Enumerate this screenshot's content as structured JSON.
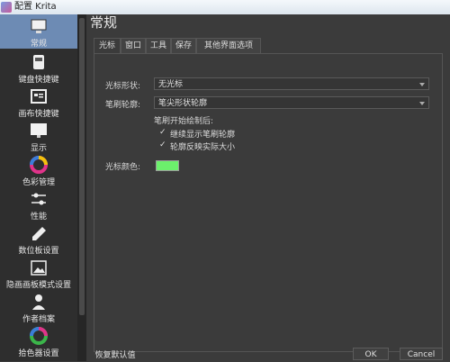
{
  "window": {
    "title": "配置 Krita"
  },
  "sidebar": {
    "items": [
      {
        "label": "常规",
        "icon": "computer-icon",
        "active": true
      },
      {
        "label": "键盘快捷键",
        "icon": "keyboard-icon"
      },
      {
        "label": "画布快捷键",
        "icon": "canvas-shortcut-icon"
      },
      {
        "label": "显示",
        "icon": "monitor-icon"
      },
      {
        "label": "色彩管理",
        "icon": "color-wheel-icon"
      },
      {
        "label": "性能",
        "icon": "sliders-icon"
      },
      {
        "label": "数位板设置",
        "icon": "pen-icon"
      },
      {
        "label": "隐画画板模式设置",
        "icon": "image-icon"
      },
      {
        "label": "作者档案",
        "icon": "person-icon"
      },
      {
        "label": "拾色器设置",
        "icon": "color-picker-icon"
      }
    ]
  },
  "main": {
    "title": "常规",
    "tabs": [
      "光标",
      "窗口",
      "工具",
      "保存",
      "其他界面选项"
    ],
    "cursor_shape": {
      "label": "光标形状:",
      "value": "无光标"
    },
    "brush_outline": {
      "label": "笔刷轮廓:",
      "value": "笔尖形状轮廓"
    },
    "after_paint_label": "笔刷开始绘制后:",
    "checkboxes": [
      {
        "label": "继续显示笔刷轮廓",
        "checked": true
      },
      {
        "label": "轮廓反映实际大小",
        "checked": true
      }
    ],
    "cursor_color": {
      "label": "光标颜色:",
      "value": "#6cf06c"
    }
  },
  "footer": {
    "restore_defaults": "恢复默认值",
    "ok": "OK",
    "cancel": "Cancel"
  }
}
